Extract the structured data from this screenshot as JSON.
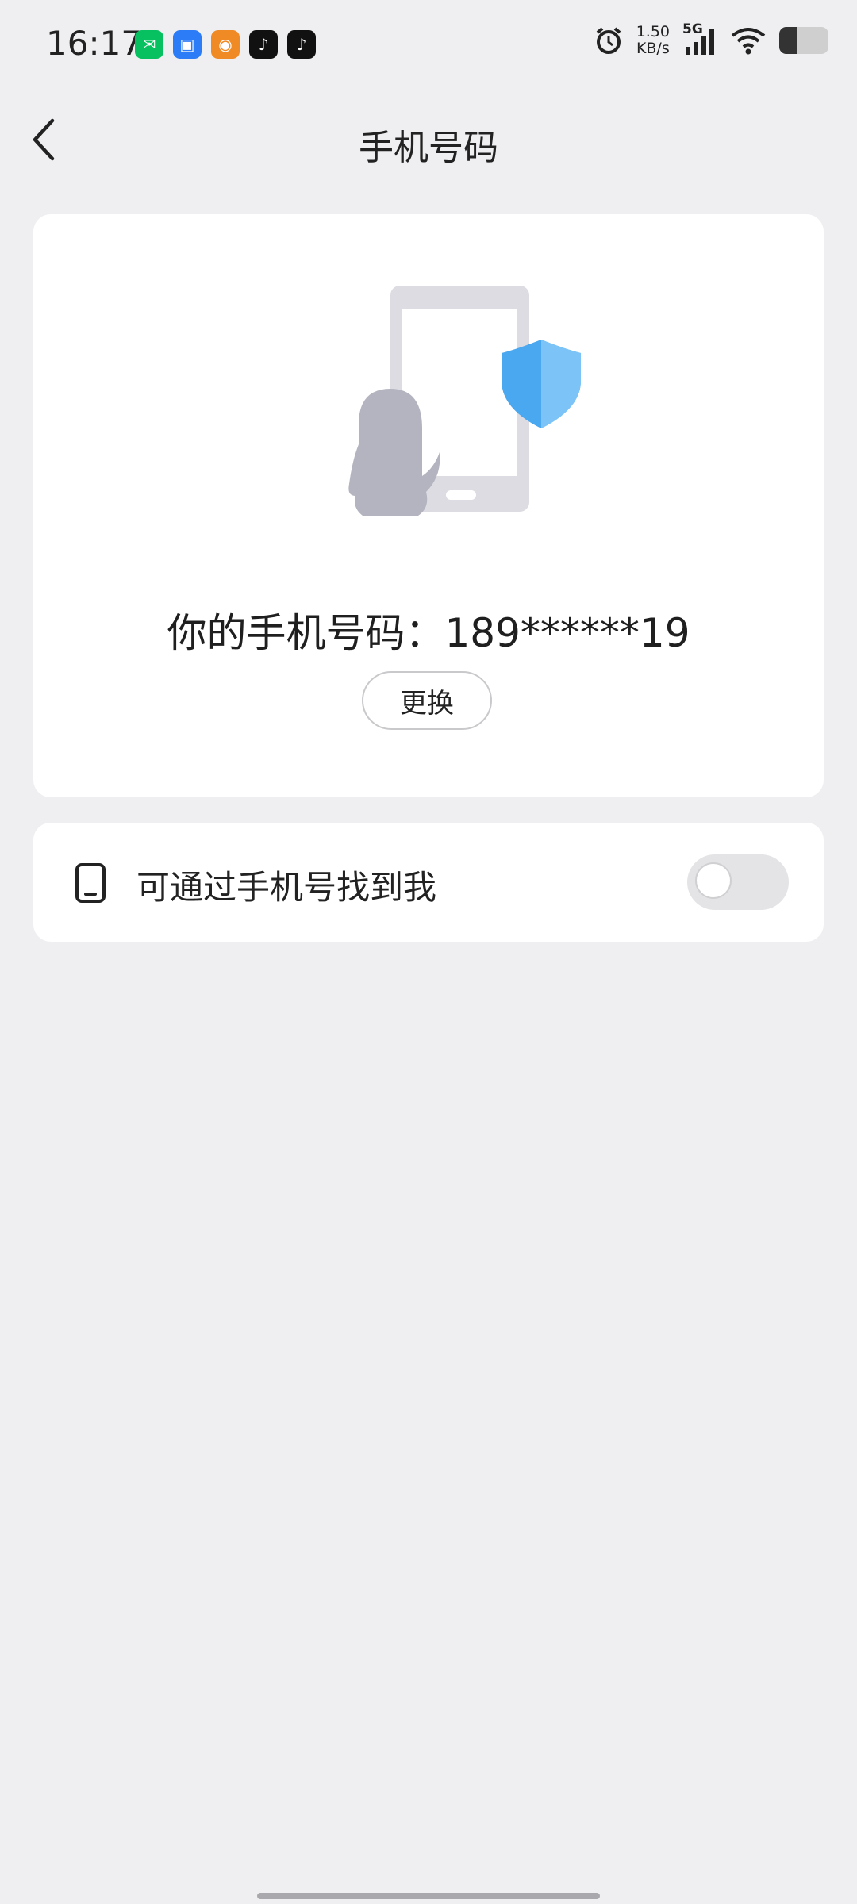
{
  "status_bar": {
    "time": "16:17",
    "net_speed_value": "1.50",
    "net_speed_unit": "KB/s",
    "network_type": "5G",
    "battery_level": 0.35,
    "apps": [
      {
        "name": "wechat-icon",
        "color": "#07c160",
        "glyph": "✉"
      },
      {
        "name": "message-app-icon",
        "color": "#2b7cf6",
        "glyph": "▣"
      },
      {
        "name": "game-app-icon",
        "color": "#f08a24",
        "glyph": "◉"
      },
      {
        "name": "tiktok-icon",
        "color": "#111111",
        "glyph": "♪"
      },
      {
        "name": "tiktok-icon-2",
        "color": "#111111",
        "glyph": "♪"
      }
    ]
  },
  "header": {
    "title": "手机号码"
  },
  "phone_card": {
    "phone_label": "你的手机号码：189******19",
    "change_button": "更换"
  },
  "setting": {
    "label": "可通过手机号找到我",
    "enabled": false
  },
  "colors": {
    "background": "#efeff2",
    "card": "#ffffff",
    "shield": "#4aa8f0"
  }
}
